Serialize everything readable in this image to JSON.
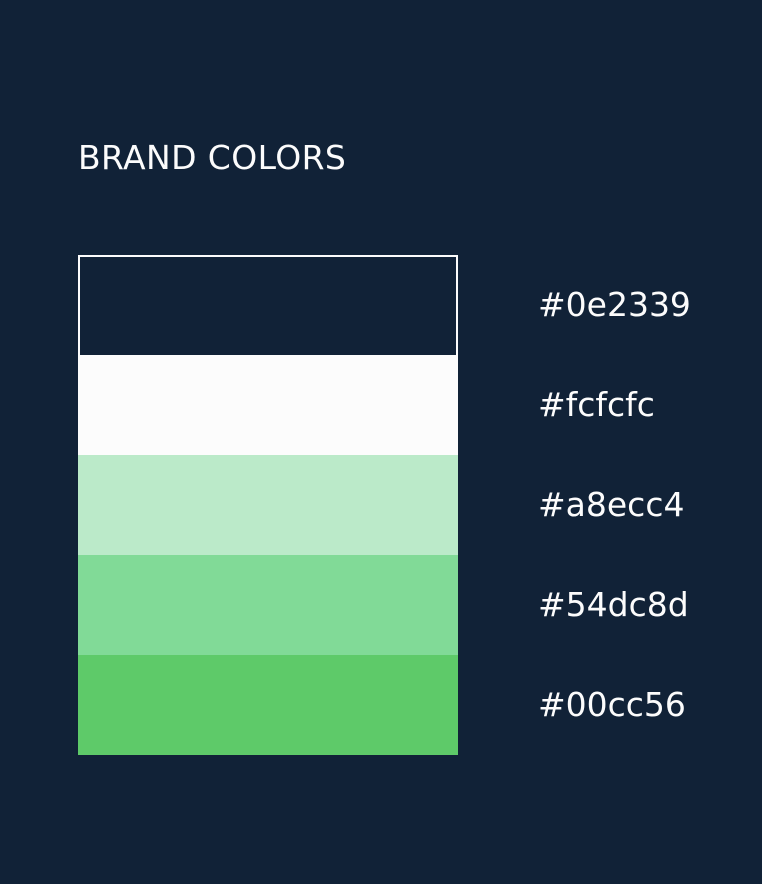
{
  "title": "BRAND COLORS",
  "swatches": [
    {
      "hex": "#0e2339",
      "color": "#112237",
      "outlined": true
    },
    {
      "hex": "#fcfcfc",
      "color": "#fcfcfc",
      "outlined": false
    },
    {
      "hex": "#a8ecc4",
      "color": "#bbeac9",
      "outlined": false
    },
    {
      "hex": "#54dc8d",
      "color": "#81da97",
      "outlined": false
    },
    {
      "hex": "#00cc56",
      "color": "#5eca69",
      "outlined": false
    }
  ]
}
